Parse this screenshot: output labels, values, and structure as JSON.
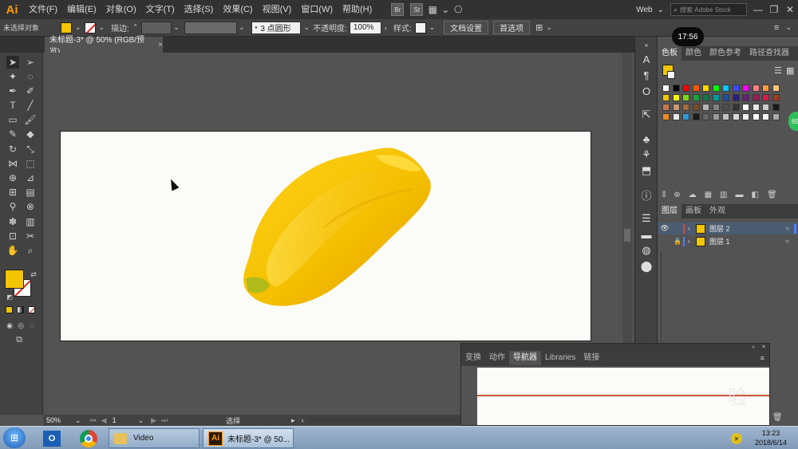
{
  "app": {
    "logo": "Ai"
  },
  "menu": [
    "文件(F)",
    "编辑(E)",
    "对象(O)",
    "文字(T)",
    "选择(S)",
    "效果(C)",
    "视图(V)",
    "窗口(W)",
    "帮助(H)"
  ],
  "menubar": {
    "bridge_icon": "Br",
    "stock_icon": "St",
    "workspace": "Web",
    "search_placeholder": "搜索 Adobe Stock",
    "window_controls": [
      "—",
      "❐",
      "✕"
    ]
  },
  "options": {
    "selection_status": "未选择对象",
    "fill_color": "#f2c500",
    "stroke_label": "描边:",
    "brush_preset": "3 点圆形",
    "opacity_label": "不透明度:",
    "opacity_value": "100%",
    "style_label": "样式:",
    "doc_setup": "文档设置",
    "preferences": "首选项"
  },
  "clock_overlay": "17:56",
  "document_tab": {
    "title": "未标题-3* @ 50% (RGB/预览)",
    "close": "×"
  },
  "status": {
    "zoom": "50%",
    "page": "1",
    "tool": "选择"
  },
  "panels": {
    "swatch_tabs": [
      "色板",
      "颜色",
      "颜色参考",
      "路径查找器"
    ],
    "layer_tabs": [
      "图层",
      "画板",
      "外观"
    ],
    "layers": [
      {
        "name": "图层 2",
        "color": "#4f7cff",
        "visible": true
      },
      {
        "name": "图层 1",
        "color": "#ff4f4f",
        "visible": false
      }
    ],
    "nav_tabs": [
      "变换",
      "动作",
      "导航器",
      "Libraries",
      "链接"
    ],
    "badge": "65",
    "swatch_colors": [
      "#ffffff",
      "#000000",
      "#ff0000",
      "#ff5a00",
      "#ffd800",
      "#00ff00",
      "#00c8ff",
      "#3b4bff",
      "#ff00ff",
      "#ff7f7f",
      "#ff9a3a",
      "#ffc67a",
      "#f2c500",
      "#fff200",
      "#7fd31a",
      "#1aa33a",
      "#0f7a46",
      "#009a9a",
      "#1e4d9a",
      "#2d1e7a",
      "#6b1e7a",
      "#9a1e5a",
      "#d31e4d",
      "#9a3a1e",
      "#c87a4d",
      "#c89a7a",
      "#a36a3a",
      "#7a4d2d",
      "#b3b3b3",
      "#808080",
      "#4d4d4d",
      "#333333",
      "#ffffff",
      "#e6e6e6",
      "#cccccc",
      "#1a1a1a",
      "#f08a1e",
      "#e8e8e8",
      "#2e9ad3",
      "#1a1a1a",
      "#666666",
      "#999999",
      "#bfbfbf",
      "#d9d9d9",
      "#eeeeee",
      "#ffffff",
      "#f5f5f5",
      "#aaaaaa"
    ]
  },
  "taskbar": {
    "items": [
      {
        "label": "Video"
      },
      {
        "label": "未标题-3* @ 50..."
      }
    ],
    "time": "13:23",
    "date": "2018/6/14"
  },
  "watermark": "验"
}
